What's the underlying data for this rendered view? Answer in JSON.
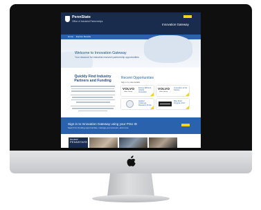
{
  "header": {
    "brand_name": "PennState",
    "brand_sub": "Office of Industrial Partnerships",
    "site_title": "Innovation Gateway"
  },
  "nav": {
    "items": [
      "Home",
      "Explore Results"
    ]
  },
  "hero": {
    "title": "Welcome to Innovation Gateway",
    "subtitle": "Your resource for industrial research partnership opportunities"
  },
  "left_column": {
    "heading": "Quickly Find Industry Partners and Funding"
  },
  "opportunities": {
    "heading": "Recent Opportunities",
    "subheading": "Sign in to view details",
    "cards": [
      {
        "logo": "VOLVO",
        "logo_sub": "Volvo Group",
        "title": "Energy Efficient Vehicle Innovation",
        "logo_type": "text"
      },
      {
        "logo": "VOLVO",
        "logo_sub": "Volvo Group",
        "title": "Innovation at the Factory",
        "logo_type": "text"
      },
      {
        "logo": "",
        "logo_sub": "",
        "title": "Applied Undersea Research Probe",
        "logo_type": "circle"
      },
      {
        "logo": "",
        "logo_sub": "",
        "title": "Blue Fluid Program 2017",
        "logo_type": "dark"
      }
    ]
  },
  "signin": {
    "title": "Sign in to Innovation Gateway using your PSU ID",
    "subtitle": "Search for funding opportunities, manage your account, and more"
  },
  "gallery": {
    "photo_caption": "invent\nPENNSTATE"
  },
  "colors": {
    "header_navy": "#1a2c4e",
    "accent_blue": "#2a62ad",
    "accent_yellow": "#f2d31d"
  },
  "icons": {
    "device_logo": "apple-icon",
    "brand_mark": "shield-icon"
  }
}
